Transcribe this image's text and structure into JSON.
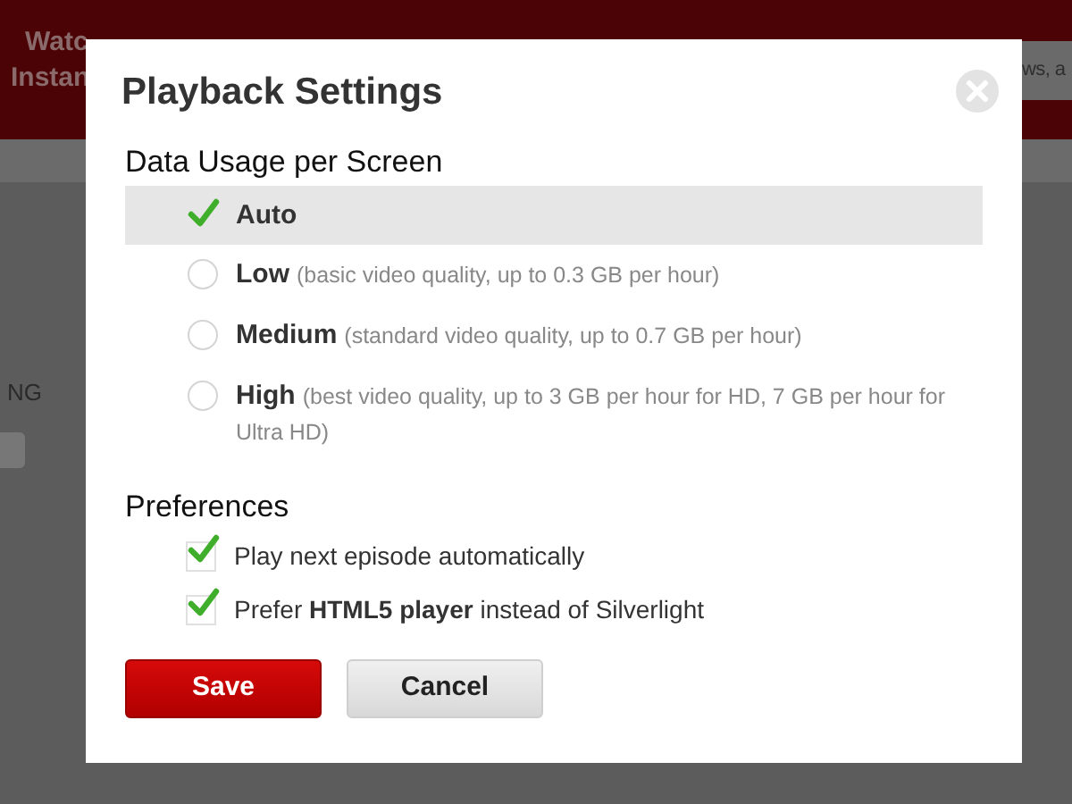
{
  "background": {
    "header_texts": [
      "Watc",
      "Instan",
      "ws, a"
    ],
    "side_text": "NG"
  },
  "dialog": {
    "title": "Playback Settings",
    "data_usage": {
      "heading": "Data Usage per Screen",
      "options": [
        {
          "label": "Auto",
          "selected": true
        },
        {
          "label": "Low",
          "description": "(basic video quality, up to 0.3 GB per hour)",
          "selected": false
        },
        {
          "label": "Medium",
          "description": "(standard video quality, up to 0.7 GB per hour)",
          "selected": false
        },
        {
          "label": "High",
          "description": "(best video quality, up to 3 GB per hour for HD, 7 GB per hour for Ultra HD)",
          "selected": false
        }
      ]
    },
    "preferences": {
      "heading": "Preferences",
      "items": [
        {
          "label": "Play next episode automatically",
          "checked": true
        },
        {
          "label": "Prefer **HTML5 player** instead of Silverlight",
          "checked": true
        }
      ]
    },
    "buttons": [
      {
        "label": "Save",
        "kind": "primary"
      },
      {
        "label": "Cancel",
        "kind": "secondary"
      }
    ]
  }
}
